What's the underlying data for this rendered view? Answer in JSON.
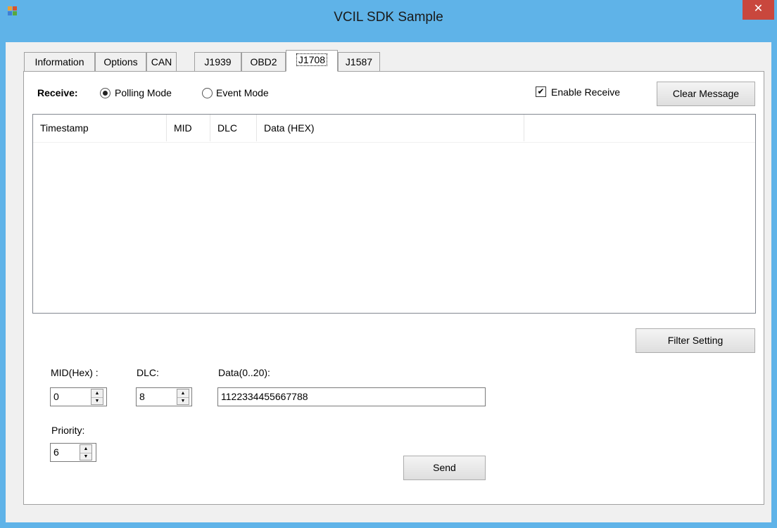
{
  "window": {
    "title": "VCIL SDK Sample",
    "close_symbol": "✕"
  },
  "tabs": [
    {
      "label": "Information"
    },
    {
      "label": "Options"
    },
    {
      "label": "CAN"
    },
    {
      "label": "J1939"
    },
    {
      "label": "OBD2"
    },
    {
      "label": "J1708"
    },
    {
      "label": "J1587"
    }
  ],
  "active_tab": "J1708",
  "receive": {
    "label": "Receive:",
    "polling_mode": "Polling Mode",
    "event_mode": "Event Mode",
    "selected": "Polling Mode",
    "enable_receive": "Enable Receive",
    "enable_checked": true,
    "clear_button": "Clear Message"
  },
  "message_table": {
    "columns": [
      "Timestamp",
      "MID",
      "DLC",
      "Data (HEX)"
    ],
    "rows": []
  },
  "filter_button": "Filter Setting",
  "send_form": {
    "mid_label": "MID(Hex) :",
    "mid_value": "0",
    "dlc_label": "DLC:",
    "dlc_value": "8",
    "data_label": "Data(0..20):",
    "data_value": "1122334455667788",
    "priority_label": "Priority:",
    "priority_value": "6",
    "send_button": "Send"
  },
  "icons": {
    "app": "app-window-icon",
    "check": "✔",
    "up": "▲",
    "down": "▼"
  }
}
